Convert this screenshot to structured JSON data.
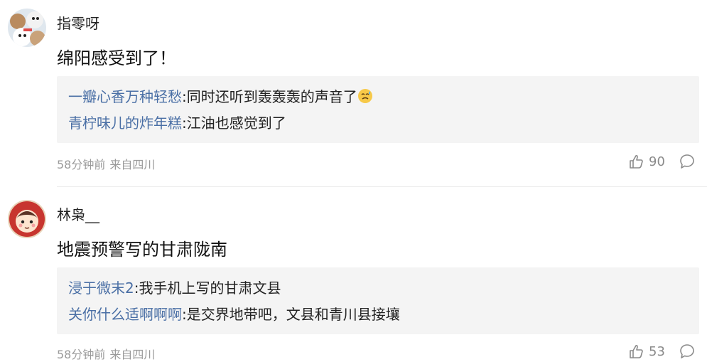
{
  "comments": [
    {
      "username": "指零呀",
      "content": "绵阳感受到了！",
      "replies": [
        {
          "name": "一瓣心香万种轻愁",
          "sep": ":",
          "text": "同时还听到轰轰轰的声音了"
        },
        {
          "name": "青柠味儿的炸年糕",
          "sep": ":",
          "text": "江油也感觉到了"
        }
      ],
      "time": "58分钟前",
      "location": "来自四川",
      "likes": "90",
      "avatar_icon": "dog-avatar-icon"
    },
    {
      "username": "林枭__",
      "content": "地震预警写的甘肃陇南",
      "replies": [
        {
          "name": "浸于微末2",
          "sep": ":",
          "text": "我手机上写的甘肃文县"
        },
        {
          "name": "关你什么适啊啊啊",
          "sep": ":",
          "text": "是交界地带吧，文县和青川县接壤"
        }
      ],
      "time": "58分钟前",
      "location": "来自四川",
      "likes": "53",
      "avatar_icon": "cartoon-girl-avatar-icon"
    }
  ],
  "colors": {
    "reply_name": "#4a6fa5",
    "reply_bg": "#f4f4f4",
    "meta": "#9a9a9a"
  }
}
